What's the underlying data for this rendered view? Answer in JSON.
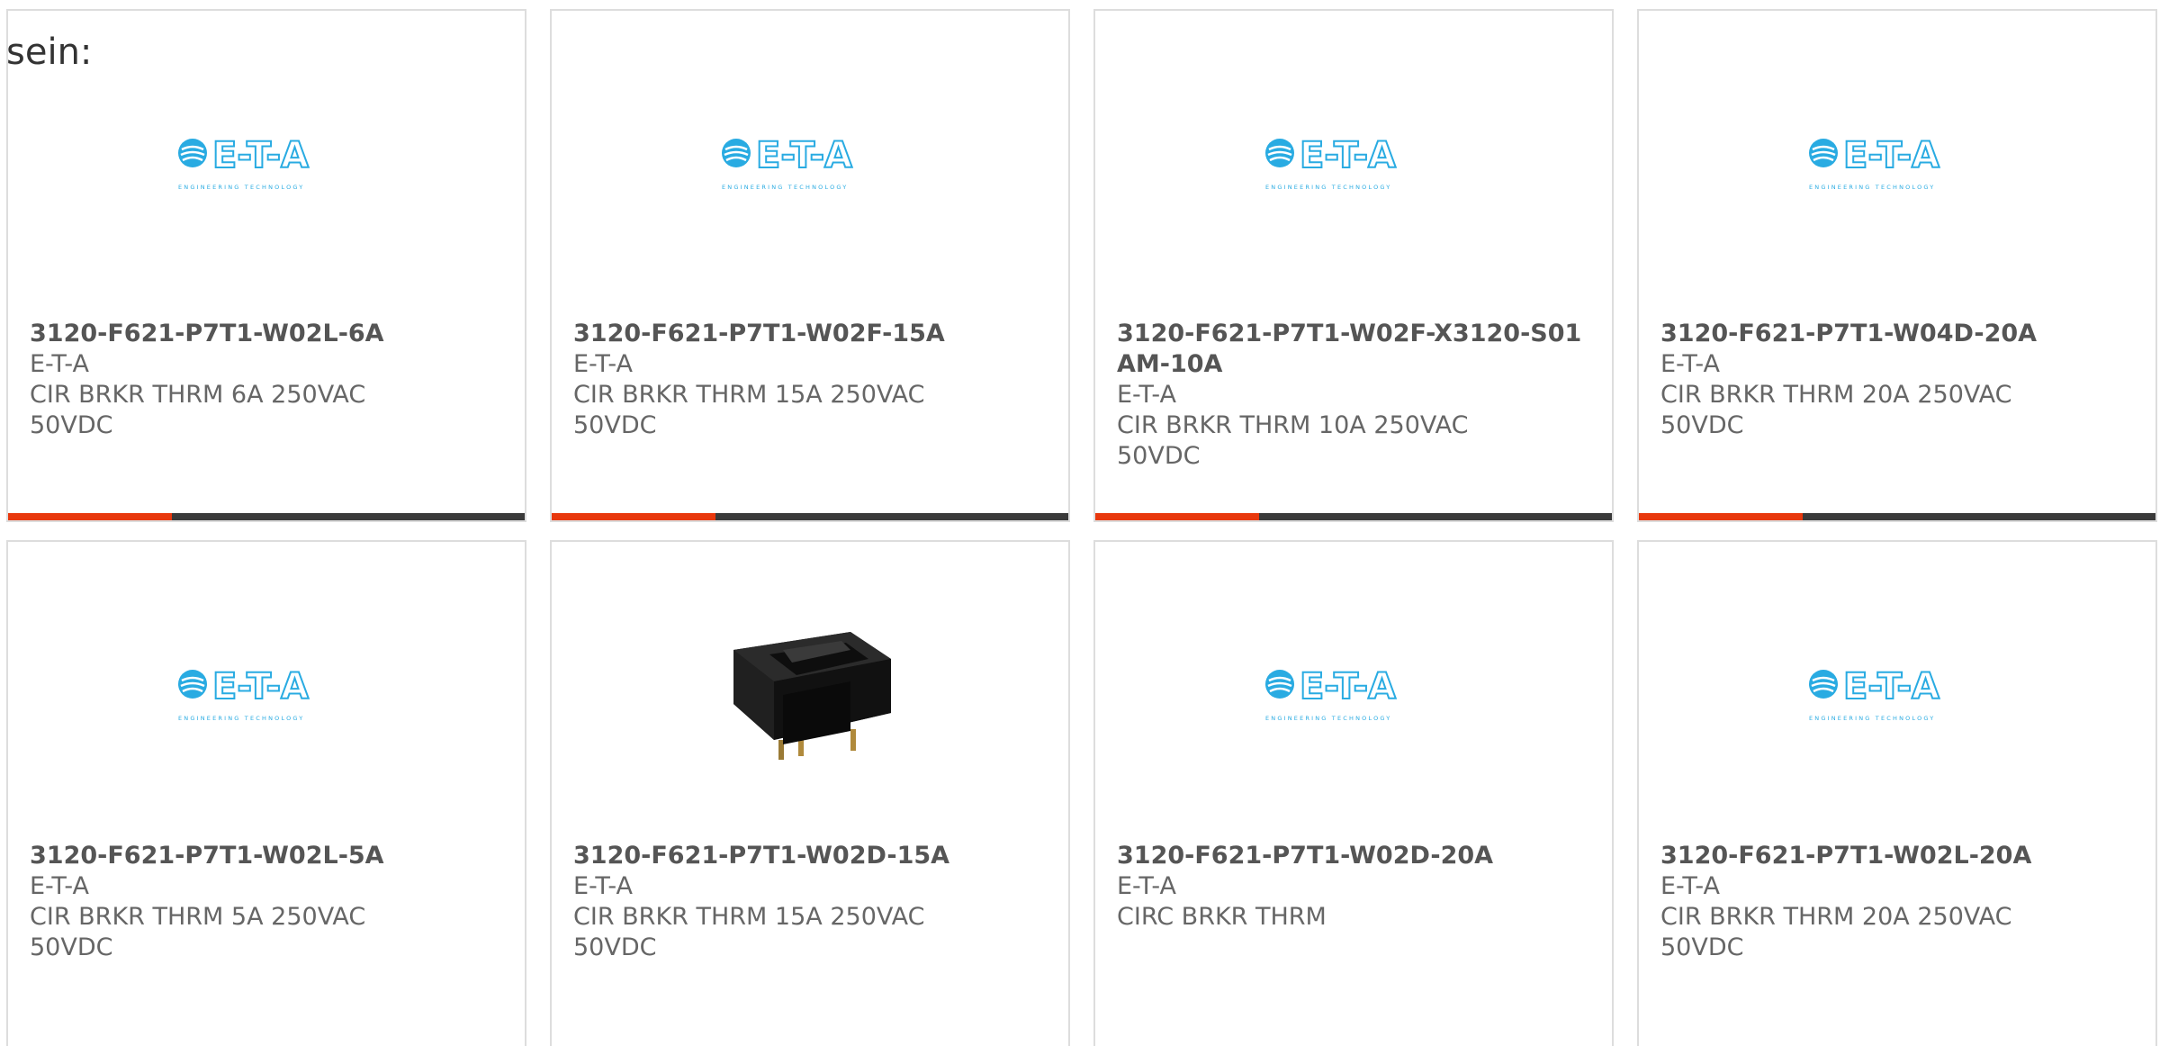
{
  "intro_text": "sein:",
  "colors": {
    "accent": "#e8380d",
    "bar": "#3a3a3a",
    "logo_blue": "#29abe2"
  },
  "logo": {
    "brand": "E-T-A",
    "tagline": "ENGINEERING TECHNOLOGY"
  },
  "products": [
    {
      "part_number": "3120-F621-P7T1-W02L-6A",
      "manufacturer": "E-T-A",
      "description": "CIR BRKR THRM 6A 250VAC 50VDC",
      "image": "eta-logo"
    },
    {
      "part_number": "3120-F621-P7T1-W02F-15A",
      "manufacturer": "E-T-A",
      "description": "CIR BRKR THRM 15A 250VAC 50VDC",
      "image": "eta-logo"
    },
    {
      "part_number": "3120-F621-P7T1-W02F-X3120-S01AM-10A",
      "manufacturer": "E-T-A",
      "description": "CIR BRKR THRM 10A 250VAC 50VDC",
      "image": "eta-logo"
    },
    {
      "part_number": "3120-F621-P7T1-W04D-20A",
      "manufacturer": "E-T-A",
      "description": "CIR BRKR THRM 20A 250VAC 50VDC",
      "image": "eta-logo"
    },
    {
      "part_number": "3120-F621-P7T1-W02L-5A",
      "manufacturer": "E-T-A",
      "description": "CIR BRKR THRM 5A 250VAC 50VDC",
      "image": "eta-logo"
    },
    {
      "part_number": "3120-F621-P7T1-W02D-15A",
      "manufacturer": "E-T-A",
      "description": "CIR BRKR THRM 15A 250VAC 50VDC",
      "image": "rocker-switch-photo"
    },
    {
      "part_number": "3120-F621-P7T1-W02D-20A",
      "manufacturer": "E-T-A",
      "description": "CIRC BRKR THRM",
      "image": "eta-logo"
    },
    {
      "part_number": "3120-F621-P7T1-W02L-20A",
      "manufacturer": "E-T-A",
      "description": "CIR BRKR THRM 20A 250VAC 50VDC",
      "image": "eta-logo"
    }
  ]
}
